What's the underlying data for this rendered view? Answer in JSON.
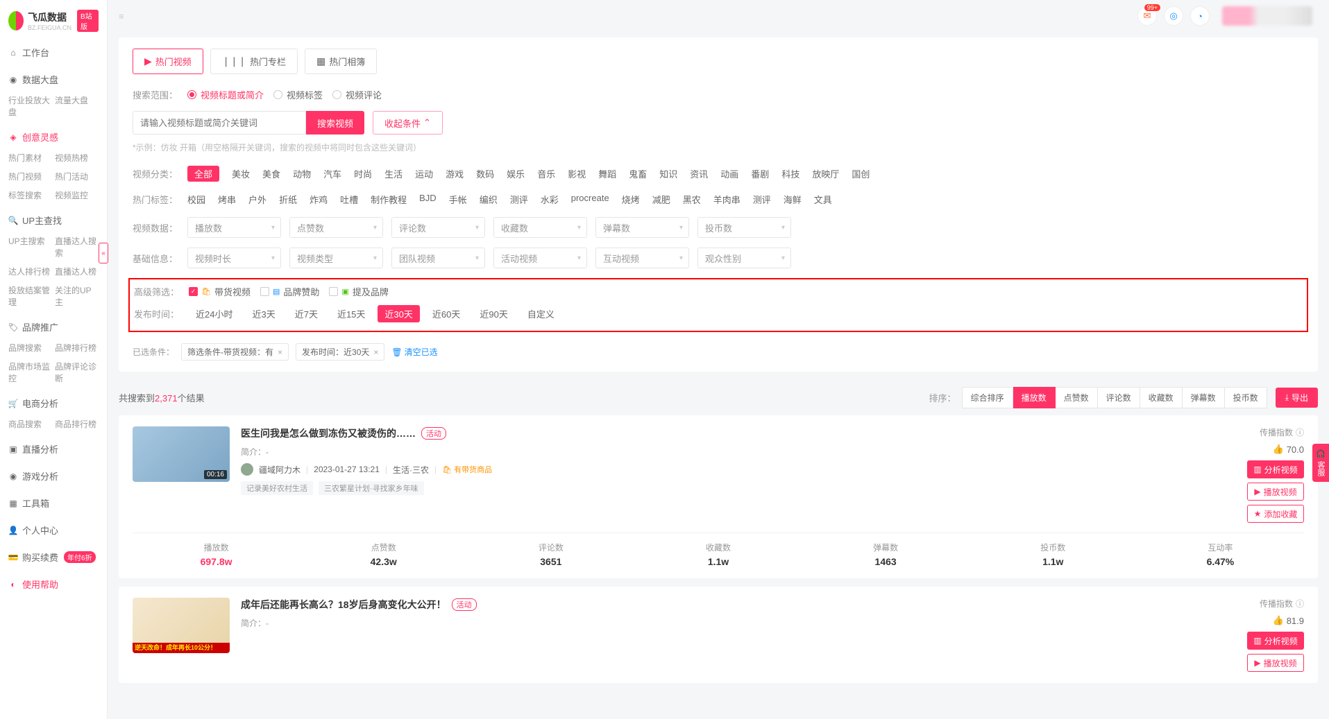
{
  "logo": {
    "name": "飞瓜数据",
    "sub": "BZ.FEIGUA.CN",
    "badge": "B站版"
  },
  "sidebar": {
    "workstation": "工作台",
    "data": {
      "head": "数据大盘",
      "links": [
        "行业投放大盘",
        "流量大盘"
      ]
    },
    "creative": {
      "head": "创意灵感",
      "links": [
        "热门素材",
        "视频热榜",
        "热门视频",
        "热门活动",
        "标签搜索",
        "视频监控"
      ]
    },
    "upsearch": {
      "head": "UP主查找",
      "links": [
        "UP主搜索",
        "直播达人搜索",
        "达人排行榜",
        "直播达人榜",
        "投放结案管理",
        "关注的UP主"
      ]
    },
    "brand": {
      "head": "品牌推广",
      "links": [
        "品牌搜索",
        "品牌排行榜",
        "品牌市场监控",
        "品牌评论诊断"
      ]
    },
    "ecom": {
      "head": "电商分析",
      "links": [
        "商品搜索",
        "商品排行榜"
      ]
    },
    "live": "直播分析",
    "game": "游戏分析",
    "toolbox": "工具箱",
    "profile": "个人中心",
    "purchase": "购买续费",
    "discount": "年付6折",
    "help": "使用帮助"
  },
  "topbar": {
    "notif": "99+"
  },
  "tabs": [
    "热门视频",
    "热门专栏",
    "热门相簿"
  ],
  "searchScope": {
    "label": "搜索范围：",
    "opts": [
      "视频标题或简介",
      "视频标签",
      "视频评论"
    ]
  },
  "searchPh": "请输入视频标题或简介关键词",
  "searchBtn": "搜索视频",
  "collapseBtn": "收起条件",
  "hint": "*示例：仿妆 开箱（用空格隔开关键词，搜索的视频中将同时包含这些关键词）",
  "videoCat": {
    "label": "视频分类：",
    "items": [
      "全部",
      "美妆",
      "美食",
      "动物",
      "汽车",
      "时尚",
      "生活",
      "运动",
      "游戏",
      "数码",
      "娱乐",
      "音乐",
      "影视",
      "舞蹈",
      "鬼畜",
      "知识",
      "资讯",
      "动画",
      "番剧",
      "科技",
      "放映厅",
      "国创"
    ]
  },
  "hotTags": {
    "label": "热门标签：",
    "items": [
      "校园",
      "烤串",
      "户外",
      "折纸",
      "炸鸡",
      "吐槽",
      "制作教程",
      "BJD",
      "手帐",
      "编织",
      "测评",
      "水彩",
      "procreate",
      "烧烤",
      "减肥",
      "黑农",
      "羊肉串",
      "测评",
      "海鲜",
      "文具"
    ]
  },
  "videoData": {
    "label": "视频数据：",
    "sels": [
      "播放数",
      "点赞数",
      "评论数",
      "收藏数",
      "弹幕数",
      "投币数"
    ]
  },
  "basicInfo": {
    "label": "基础信息：",
    "sels": [
      "视频时长",
      "视频类型",
      "团队视频",
      "活动视频",
      "互动视频",
      "观众性别"
    ]
  },
  "advFilter": {
    "label": "高级筛选：",
    "opts": [
      "带货视频",
      "品牌赞助",
      "提及品牌"
    ]
  },
  "pubTime": {
    "label": "发布时间：",
    "opts": [
      "近24小时",
      "近3天",
      "近7天",
      "近15天",
      "近30天",
      "近60天",
      "近90天",
      "自定义"
    ]
  },
  "selected": {
    "label": "已选条件：",
    "tags": [
      "筛选条件-带货视频：有",
      "发布时间：近30天"
    ],
    "clear": "清空已选"
  },
  "results": {
    "prefix": "共搜索到",
    "count": "2,371",
    "suffix": "个结果"
  },
  "sort": {
    "label": "排序：",
    "opts": [
      "综合排序",
      "播放数",
      "点赞数",
      "评论数",
      "收藏数",
      "弹幕数",
      "投币数"
    ],
    "export": "导出"
  },
  "videos": [
    {
      "title": "医生问我是怎么做到冻伤又被烫伤的……",
      "badge": "活动",
      "desc": "简介：-",
      "author": "疆域阿力木",
      "date": "2023-01-27 13:21",
      "cat": "生活·三农",
      "goods": "有带货商品",
      "tags": [
        "记录美好农村生活",
        "三农繁星计划·寻找家乡年味"
      ],
      "dur": "00:16",
      "spreadLbl": "传播指数",
      "score": "70.0",
      "actions": [
        "分析视频",
        "播放视频",
        "添加收藏"
      ],
      "stats": [
        {
          "lbl": "播放数",
          "val": "697.8w",
          "pink": true
        },
        {
          "lbl": "点赞数",
          "val": "42.3w"
        },
        {
          "lbl": "评论数",
          "val": "3651"
        },
        {
          "lbl": "收藏数",
          "val": "1.1w"
        },
        {
          "lbl": "弹幕数",
          "val": "1463"
        },
        {
          "lbl": "投币数",
          "val": "1.1w"
        },
        {
          "lbl": "互动率",
          "val": "6.47%"
        }
      ]
    },
    {
      "title": "成年后还能再长高么？18岁后身高变化大公开！",
      "badge": "活动",
      "desc": "简介：-",
      "band": "逆天改命！成年再长10公分！",
      "spreadLbl": "传播指数",
      "score": "81.9",
      "actions": [
        "分析视频",
        "播放视频"
      ]
    }
  ],
  "floatHelp": "客服"
}
